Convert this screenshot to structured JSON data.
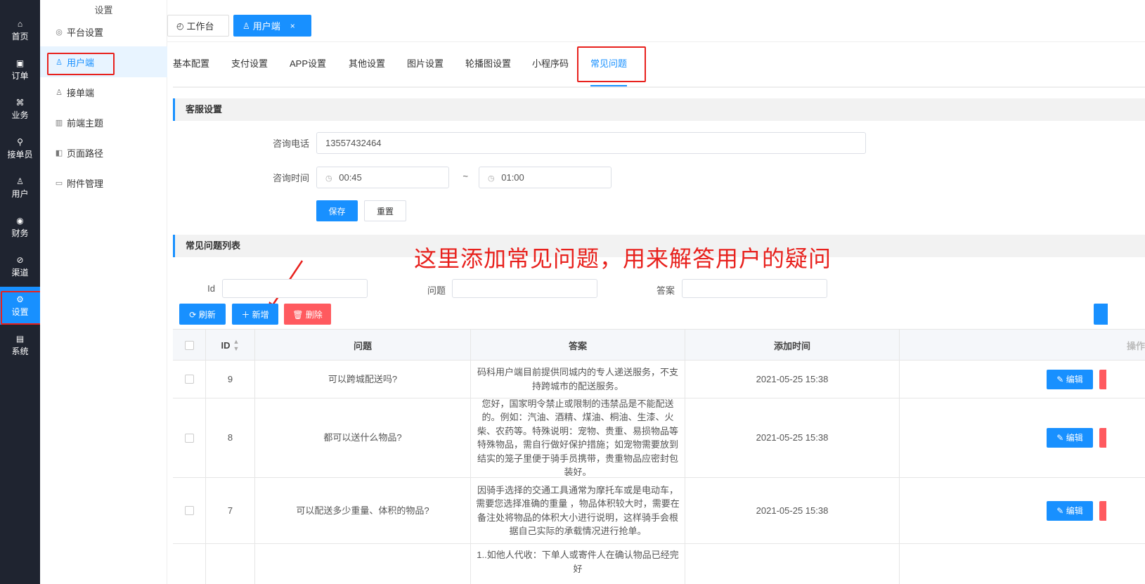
{
  "leftnav": {
    "items": [
      {
        "icon": "⌂",
        "label": "首页"
      },
      {
        "icon": "▣",
        "label": "订单"
      },
      {
        "icon": "⌘",
        "label": "业务"
      },
      {
        "icon": "⚲",
        "label": "接单员"
      },
      {
        "icon": "♙",
        "label": "用户"
      },
      {
        "icon": "◉",
        "label": "财务"
      },
      {
        "icon": "⊘",
        "label": "渠道"
      },
      {
        "icon": "⚙",
        "label": "设置"
      },
      {
        "icon": "▤",
        "label": "系统"
      }
    ]
  },
  "subnav": {
    "title": "设置",
    "items": [
      {
        "icon": "◎",
        "label": "平台设置"
      },
      {
        "icon": "♙",
        "label": "用户端"
      },
      {
        "icon": "♙",
        "label": "接单端"
      },
      {
        "icon": "▥",
        "label": "前端主题"
      },
      {
        "icon": "◧",
        "label": "页面路径"
      },
      {
        "icon": "▭",
        "label": "附件管理"
      }
    ]
  },
  "topbar": {
    "tabs": [
      {
        "icon": "◴",
        "label": "工作台"
      },
      {
        "icon": "♙",
        "label": "用户端",
        "close": "×"
      }
    ]
  },
  "tabs": [
    "基本配置",
    "支付设置",
    "APP设置",
    "其他设置",
    "图片设置",
    "轮播图设置",
    "小程序码",
    "常见问题"
  ],
  "service": {
    "title": "客服设置",
    "phone_label": "咨询电话",
    "phone_value": "13557432464",
    "time_label": "咨询时间",
    "time_start": "00:45",
    "time_sep": "~",
    "time_end": "01:00",
    "save_label": "保存",
    "reset_label": "重置"
  },
  "faq": {
    "title": "常见问题列表",
    "annotation": "这里添加常见问题，用来解答用户的疑问",
    "filters": {
      "id_label": "Id",
      "question_label": "问题",
      "answer_label": "答案"
    },
    "refresh_label": "刷新",
    "add_label": "新增",
    "delete_label": "删除",
    "columns": {
      "id": "ID",
      "question": "问题",
      "answer": "答案",
      "time": "添加时间",
      "ops": "操作"
    },
    "edit_label": "编辑",
    "rows": [
      {
        "id": "9",
        "question": "可以跨城配送吗?",
        "answer": "码科用户端目前提供同城内的专人递送服务，不支持跨城市的配送服务。",
        "time": "2021-05-25 15:38"
      },
      {
        "id": "8",
        "question": "都可以送什么物品?",
        "answer": "您好，国家明令禁止或限制的违禁品是不能配送的。例如：汽油、酒精、煤油、桐油、生漆、火柴、农药等。特殊说明：宠物、贵重、易损物品等特殊物品，需自行做好保护措施；如宠物需要放到结实的笼子里便于骑手员携带，贵重物品应密封包装好。",
        "time": "2021-05-25 15:38"
      },
      {
        "id": "7",
        "question": "可以配送多少重量、体积的物品?",
        "answer": "因骑手选择的交通工具通常为摩托车或是电动车，需要您选择准确的重量 ，物品体积较大时，需要在备注处将物品的体积大小进行说明，这样骑手会根据自己实际的承载情况进行抢单。",
        "time": "2021-05-25 15:38"
      },
      {
        "answer": "1..如他人代收：下单人或寄件人在确认物品已经完好"
      }
    ]
  }
}
